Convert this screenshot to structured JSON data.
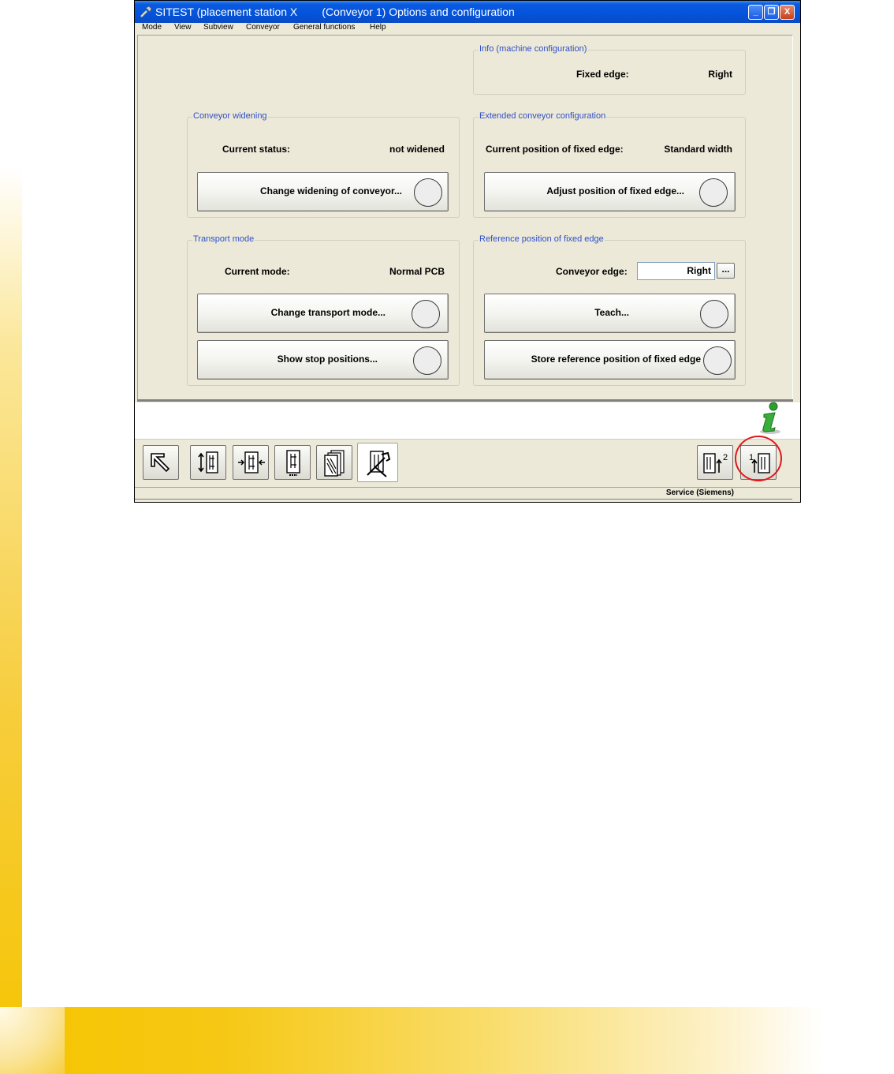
{
  "window": {
    "title": "SITEST (placement station X        (Conveyor 1) Options and configuration",
    "controls": {
      "minimize": "_",
      "restore": "❐",
      "close": "X"
    }
  },
  "menu": [
    "Mode",
    "View",
    "Subview",
    "Conveyor",
    "General functions",
    "Help"
  ],
  "info_machine": {
    "legend": "Info (machine configuration)",
    "fixed_edge_label": "Fixed edge:",
    "fixed_edge_value": "Right"
  },
  "conveyor_widening": {
    "legend": "Conveyor widening",
    "status_label": "Current status:",
    "status_value": "not widened",
    "button": "Change widening of conveyor..."
  },
  "extended_config": {
    "legend": "Extended conveyor configuration",
    "position_label": "Current position of fixed edge:",
    "position_value": "Standard width",
    "button": "Adjust position of fixed edge..."
  },
  "transport_mode": {
    "legend": "Transport mode",
    "mode_label": "Current mode:",
    "mode_value": "Normal PCB",
    "change_button": "Change transport mode...",
    "stops_button": "Show stop positions..."
  },
  "reference_position": {
    "legend": "Reference position of fixed edge",
    "edge_label": "Conveyor edge:",
    "edge_value": "Right",
    "browse_button": "...",
    "teach_button": "Teach...",
    "store_button": "Store reference position of fixed edge"
  },
  "toolbar": {
    "left_buttons": [
      "pointer-arrow-icon",
      "conveyor-width-icon",
      "conveyor-center-icon",
      "conveyor-single-icon",
      "conveyor-multi-icon",
      "conveyor-config-tools-icon"
    ],
    "right_buttons": [
      "conveyor-2-icon",
      "conveyor-1-icon"
    ],
    "right_button_numbers": [
      "2",
      "1"
    ]
  },
  "statusbar": {
    "text": "Service (Siemens)"
  },
  "colors": {
    "legend_blue": "#2f4fc8",
    "highlight_red": "#e3151c",
    "title_blue": "#0353db"
  }
}
